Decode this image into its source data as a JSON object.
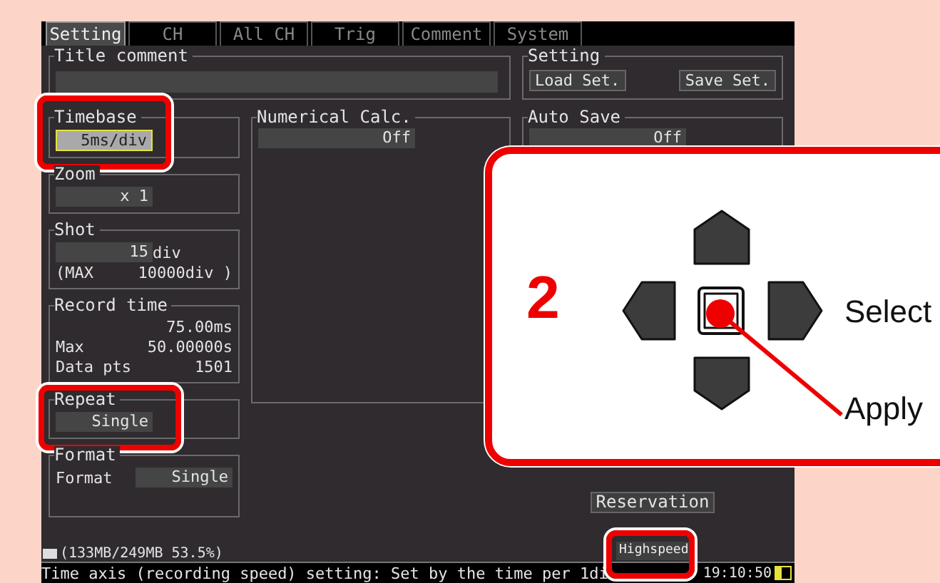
{
  "tabs": [
    {
      "label": "Setting",
      "selected": true
    },
    {
      "label": "CH",
      "selected": false
    },
    {
      "label": "All CH",
      "selected": false
    },
    {
      "label": "Trig",
      "selected": false
    },
    {
      "label": "Comment",
      "selected": false
    },
    {
      "label": "System",
      "selected": false
    }
  ],
  "title_comment": {
    "label": "Title comment"
  },
  "setting": {
    "label": "Setting",
    "buttons": [
      "Load Set.",
      "Save Set."
    ]
  },
  "timebase": {
    "label": "Timebase",
    "value": "5ms/div",
    "focused": true,
    "highlighted": true
  },
  "zoom": {
    "label": "Zoom",
    "value": "x 1"
  },
  "shot": {
    "label": "Shot",
    "value": "15",
    "unit": "div",
    "max_label": "(MAX",
    "max_value": "10000div )"
  },
  "record_time": {
    "label": "Record time",
    "value": "75.00ms",
    "max_label": "Max",
    "max_value": "50.00000s",
    "points_label": "Data pts",
    "points_value": "1501"
  },
  "repeat": {
    "label": "Repeat",
    "value": "Single",
    "focused": false,
    "highlighted": true
  },
  "format": {
    "label": "Format",
    "field_label": "Format",
    "value": "Single"
  },
  "numerical_calc": {
    "label": "Numerical Calc.",
    "value": "Off"
  },
  "auto_save": {
    "label": "Auto Save",
    "value": "Off"
  },
  "reservation": "Reservation",
  "storage": "(133MB/249MB 53.5%)",
  "message": "Time axis (recording speed) setting: Set by the time per 1di",
  "mode": {
    "label": "Highspeed",
    "highlighted": true
  },
  "clock": "19:10:50",
  "callout": {
    "step": "2",
    "labels": [
      "Select",
      "Apply"
    ]
  }
}
